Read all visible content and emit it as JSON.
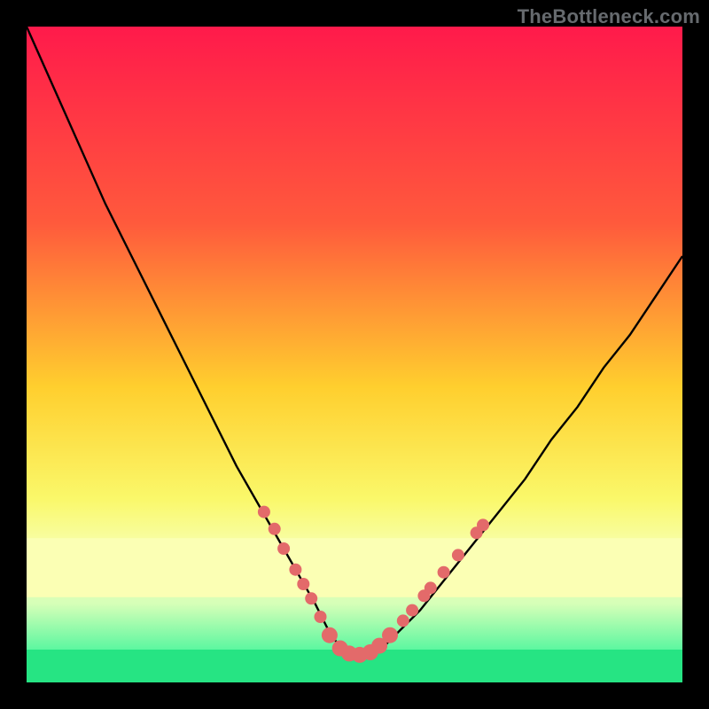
{
  "watermark": "TheBottleneck.com",
  "chart_data": {
    "type": "line",
    "title": "",
    "xlabel": "",
    "ylabel": "",
    "xlim": [
      0,
      100
    ],
    "ylim": [
      0,
      100
    ],
    "gradient_stops": [
      {
        "offset": 0,
        "color": "#ff1a4b"
      },
      {
        "offset": 30,
        "color": "#ff5a3c"
      },
      {
        "offset": 55,
        "color": "#ffcf2e"
      },
      {
        "offset": 72,
        "color": "#faf86a"
      },
      {
        "offset": 80,
        "color": "#f7ffb0"
      },
      {
        "offset": 88,
        "color": "#d6ffb8"
      },
      {
        "offset": 95,
        "color": "#5cf7a0"
      },
      {
        "offset": 100,
        "color": "#18e07a"
      }
    ],
    "yellow_band": {
      "y0": 78,
      "y1": 87,
      "color": "#fbffb4"
    },
    "green_band": {
      "y0": 95,
      "y1": 100,
      "color": "#26e483"
    },
    "series": [
      {
        "name": "curve",
        "x": [
          0,
          4,
          8,
          12,
          16,
          20,
          24,
          28,
          32,
          36,
          40,
          44,
          46,
          48,
          50,
          52,
          54,
          56,
          60,
          64,
          68,
          72,
          76,
          80,
          84,
          88,
          92,
          96,
          100
        ],
        "y": [
          0,
          9,
          18,
          27,
          35,
          43,
          51,
          59,
          67,
          74,
          81,
          88,
          92,
          95,
          96,
          96,
          95,
          93,
          89,
          84,
          79,
          74,
          69,
          63,
          58,
          52,
          47,
          41,
          35
        ]
      }
    ],
    "markers": {
      "color": "#e36a6a",
      "radius_small": 7,
      "radius_large": 9,
      "points": [
        {
          "x": 36.2,
          "y": 74.0,
          "r": 7
        },
        {
          "x": 37.8,
          "y": 76.6,
          "r": 7
        },
        {
          "x": 39.2,
          "y": 79.6,
          "r": 7
        },
        {
          "x": 41.0,
          "y": 82.8,
          "r": 7
        },
        {
          "x": 42.2,
          "y": 85.0,
          "r": 7
        },
        {
          "x": 43.4,
          "y": 87.2,
          "r": 7
        },
        {
          "x": 44.8,
          "y": 90.0,
          "r": 7
        },
        {
          "x": 46.2,
          "y": 92.8,
          "r": 9
        },
        {
          "x": 47.8,
          "y": 94.8,
          "r": 9
        },
        {
          "x": 49.2,
          "y": 95.6,
          "r": 9
        },
        {
          "x": 50.8,
          "y": 95.8,
          "r": 9
        },
        {
          "x": 52.4,
          "y": 95.4,
          "r": 9
        },
        {
          "x": 53.8,
          "y": 94.4,
          "r": 9
        },
        {
          "x": 55.4,
          "y": 92.8,
          "r": 9
        },
        {
          "x": 57.4,
          "y": 90.6,
          "r": 7
        },
        {
          "x": 58.8,
          "y": 89.0,
          "r": 7
        },
        {
          "x": 60.6,
          "y": 86.8,
          "r": 7
        },
        {
          "x": 61.6,
          "y": 85.6,
          "r": 7
        },
        {
          "x": 63.6,
          "y": 83.2,
          "r": 7
        },
        {
          "x": 65.8,
          "y": 80.6,
          "r": 7
        },
        {
          "x": 68.6,
          "y": 77.2,
          "r": 7
        },
        {
          "x": 69.6,
          "y": 76.0,
          "r": 7
        }
      ]
    }
  }
}
